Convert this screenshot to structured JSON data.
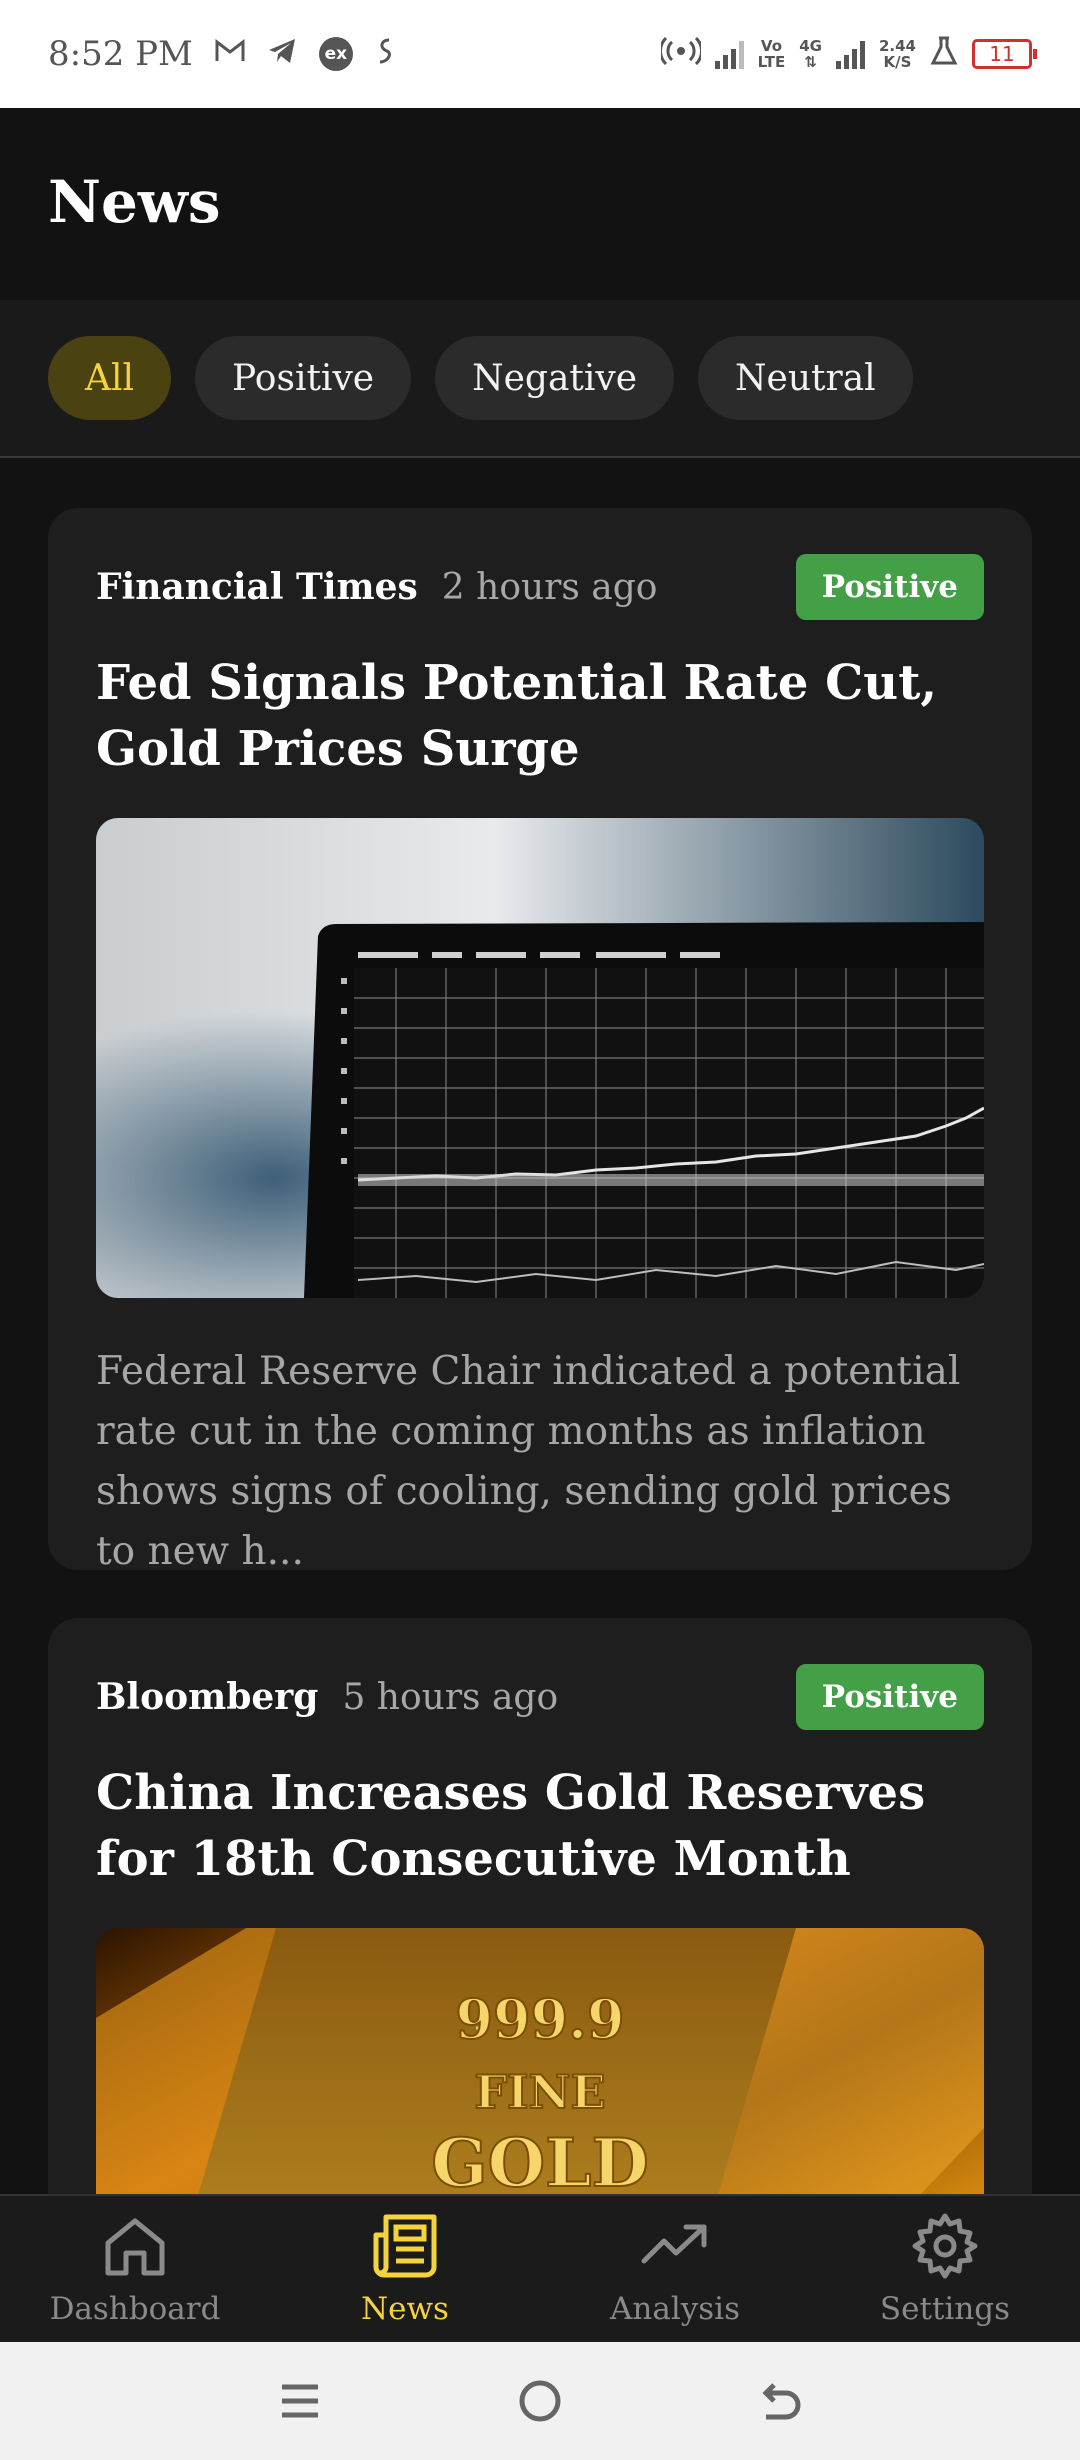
{
  "status_bar": {
    "time": "8:52 PM",
    "net_speed_value": "2.44",
    "net_speed_unit": "K/S",
    "volte_top": "Vo",
    "volte_bottom": "LTE",
    "network_type": "4G",
    "battery_level": "11"
  },
  "header": {
    "title": "News"
  },
  "filters": [
    {
      "label": "All",
      "active": true
    },
    {
      "label": "Positive",
      "active": false
    },
    {
      "label": "Negative",
      "active": false
    },
    {
      "label": "Neutral",
      "active": false
    }
  ],
  "articles": [
    {
      "source": "Financial Times",
      "time": "2 hours ago",
      "sentiment": "Positive",
      "headline": "Fed Signals Potential Rate Cut, Gold Prices Surge",
      "summary": "Federal Reserve Chair indicated a potential rate cut in the coming months as inflation shows signs of cooling, sending gold prices to new h..."
    },
    {
      "source": "Bloomberg",
      "time": "5 hours ago",
      "sentiment": "Positive",
      "headline": "China Increases Gold Reserves for 18th Consecutive Month",
      "image_text_line1": "999.9",
      "image_text_line2": "FINE",
      "image_text_line3": "GOLD"
    }
  ],
  "bottom_nav": [
    {
      "label": "Dashboard",
      "icon": "home-icon",
      "active": false
    },
    {
      "label": "News",
      "icon": "newspaper-icon",
      "active": true
    },
    {
      "label": "Analysis",
      "icon": "trending-up-icon",
      "active": false
    },
    {
      "label": "Settings",
      "icon": "gear-icon",
      "active": false
    }
  ],
  "colors": {
    "accent": "#f5d33c",
    "positive": "#43a047",
    "background": "#121212",
    "card": "#1e1e1e"
  }
}
